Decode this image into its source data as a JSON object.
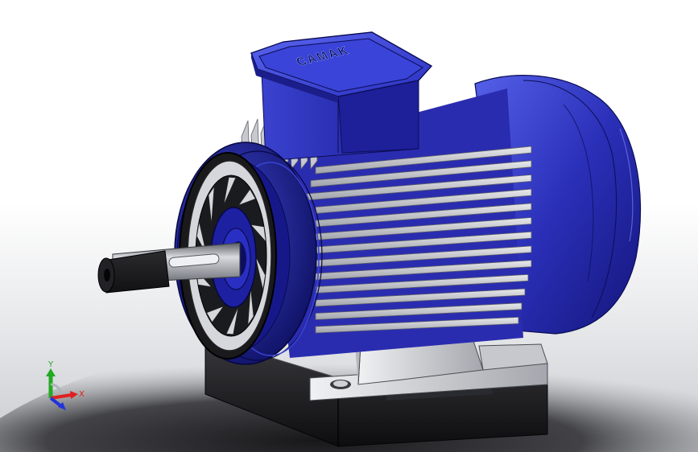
{
  "scene": {
    "subject": "electric-motor-3d-model",
    "nameplate_text": "CAMAK",
    "colors": {
      "body_blue": "#2a2fb8",
      "body_blue_dark": "#13157a",
      "body_blue_light": "#4b55e0",
      "fin_grey": "#c9cbd1",
      "fin_grey_dark": "#8a8d96",
      "shaft_grey": "#a9acb3",
      "base_black": "#1a1a1c",
      "mount_grey": "#d4d6da",
      "background_shadow": "#1b1b1f"
    }
  },
  "triad": {
    "x_label": "X",
    "y_label": "Y",
    "x_color": "#e02020",
    "y_color": "#22aa22",
    "z_color": "#2233dd"
  }
}
